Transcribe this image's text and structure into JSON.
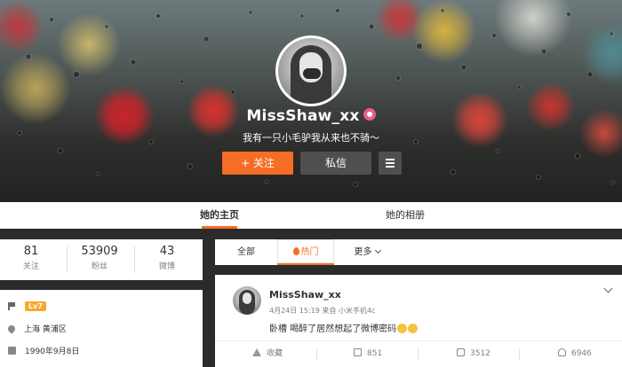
{
  "profile": {
    "username": "MissShaw_xx",
    "bio": "我有一只小毛驴我从来也不骑～",
    "follow_label": "+ 关注",
    "message_label": "私信"
  },
  "tabs": [
    {
      "label": "她的主页",
      "active": true
    },
    {
      "label": "她的相册",
      "active": false
    }
  ],
  "stats": [
    {
      "value": "81",
      "label": "关注"
    },
    {
      "value": "53909",
      "label": "粉丝"
    },
    {
      "value": "43",
      "label": "微博"
    }
  ],
  "info": {
    "level": "Lv7",
    "location": "上海 黄浦区",
    "birthday": "1990年9月8日"
  },
  "filters": {
    "all": "全部",
    "hot": "热门",
    "more": "更多"
  },
  "post": {
    "author": "MissShaw_xx",
    "meta": "4月24日 15:19 来自 小米手机4c",
    "text": "卧槽 喝醉了居然想起了微博密码",
    "actions": {
      "favorite": "收藏",
      "share": "851",
      "comment": "3512",
      "like": "6946"
    }
  },
  "colors": {
    "accent": "#f66d25",
    "vip": "#e65e8d",
    "level_badge": "#f8a82d"
  }
}
